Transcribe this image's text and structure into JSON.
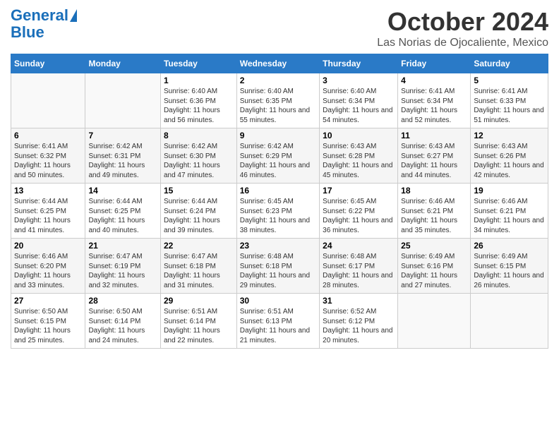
{
  "logo": {
    "line1": "General",
    "line2": "Blue"
  },
  "title": "October 2024",
  "subtitle": "Las Norias de Ojocaliente, Mexico",
  "days_of_week": [
    "Sunday",
    "Monday",
    "Tuesday",
    "Wednesday",
    "Thursday",
    "Friday",
    "Saturday"
  ],
  "weeks": [
    [
      {
        "day": "",
        "content": ""
      },
      {
        "day": "",
        "content": ""
      },
      {
        "day": "1",
        "content": "Sunrise: 6:40 AM\nSunset: 6:36 PM\nDaylight: 11 hours and 56 minutes."
      },
      {
        "day": "2",
        "content": "Sunrise: 6:40 AM\nSunset: 6:35 PM\nDaylight: 11 hours and 55 minutes."
      },
      {
        "day": "3",
        "content": "Sunrise: 6:40 AM\nSunset: 6:34 PM\nDaylight: 11 hours and 54 minutes."
      },
      {
        "day": "4",
        "content": "Sunrise: 6:41 AM\nSunset: 6:34 PM\nDaylight: 11 hours and 52 minutes."
      },
      {
        "day": "5",
        "content": "Sunrise: 6:41 AM\nSunset: 6:33 PM\nDaylight: 11 hours and 51 minutes."
      }
    ],
    [
      {
        "day": "6",
        "content": "Sunrise: 6:41 AM\nSunset: 6:32 PM\nDaylight: 11 hours and 50 minutes."
      },
      {
        "day": "7",
        "content": "Sunrise: 6:42 AM\nSunset: 6:31 PM\nDaylight: 11 hours and 49 minutes."
      },
      {
        "day": "8",
        "content": "Sunrise: 6:42 AM\nSunset: 6:30 PM\nDaylight: 11 hours and 47 minutes."
      },
      {
        "day": "9",
        "content": "Sunrise: 6:42 AM\nSunset: 6:29 PM\nDaylight: 11 hours and 46 minutes."
      },
      {
        "day": "10",
        "content": "Sunrise: 6:43 AM\nSunset: 6:28 PM\nDaylight: 11 hours and 45 minutes."
      },
      {
        "day": "11",
        "content": "Sunrise: 6:43 AM\nSunset: 6:27 PM\nDaylight: 11 hours and 44 minutes."
      },
      {
        "day": "12",
        "content": "Sunrise: 6:43 AM\nSunset: 6:26 PM\nDaylight: 11 hours and 42 minutes."
      }
    ],
    [
      {
        "day": "13",
        "content": "Sunrise: 6:44 AM\nSunset: 6:25 PM\nDaylight: 11 hours and 41 minutes."
      },
      {
        "day": "14",
        "content": "Sunrise: 6:44 AM\nSunset: 6:25 PM\nDaylight: 11 hours and 40 minutes."
      },
      {
        "day": "15",
        "content": "Sunrise: 6:44 AM\nSunset: 6:24 PM\nDaylight: 11 hours and 39 minutes."
      },
      {
        "day": "16",
        "content": "Sunrise: 6:45 AM\nSunset: 6:23 PM\nDaylight: 11 hours and 38 minutes."
      },
      {
        "day": "17",
        "content": "Sunrise: 6:45 AM\nSunset: 6:22 PM\nDaylight: 11 hours and 36 minutes."
      },
      {
        "day": "18",
        "content": "Sunrise: 6:46 AM\nSunset: 6:21 PM\nDaylight: 11 hours and 35 minutes."
      },
      {
        "day": "19",
        "content": "Sunrise: 6:46 AM\nSunset: 6:21 PM\nDaylight: 11 hours and 34 minutes."
      }
    ],
    [
      {
        "day": "20",
        "content": "Sunrise: 6:46 AM\nSunset: 6:20 PM\nDaylight: 11 hours and 33 minutes."
      },
      {
        "day": "21",
        "content": "Sunrise: 6:47 AM\nSunset: 6:19 PM\nDaylight: 11 hours and 32 minutes."
      },
      {
        "day": "22",
        "content": "Sunrise: 6:47 AM\nSunset: 6:18 PM\nDaylight: 11 hours and 31 minutes."
      },
      {
        "day": "23",
        "content": "Sunrise: 6:48 AM\nSunset: 6:18 PM\nDaylight: 11 hours and 29 minutes."
      },
      {
        "day": "24",
        "content": "Sunrise: 6:48 AM\nSunset: 6:17 PM\nDaylight: 11 hours and 28 minutes."
      },
      {
        "day": "25",
        "content": "Sunrise: 6:49 AM\nSunset: 6:16 PM\nDaylight: 11 hours and 27 minutes."
      },
      {
        "day": "26",
        "content": "Sunrise: 6:49 AM\nSunset: 6:15 PM\nDaylight: 11 hours and 26 minutes."
      }
    ],
    [
      {
        "day": "27",
        "content": "Sunrise: 6:50 AM\nSunset: 6:15 PM\nDaylight: 11 hours and 25 minutes."
      },
      {
        "day": "28",
        "content": "Sunrise: 6:50 AM\nSunset: 6:14 PM\nDaylight: 11 hours and 24 minutes."
      },
      {
        "day": "29",
        "content": "Sunrise: 6:51 AM\nSunset: 6:14 PM\nDaylight: 11 hours and 22 minutes."
      },
      {
        "day": "30",
        "content": "Sunrise: 6:51 AM\nSunset: 6:13 PM\nDaylight: 11 hours and 21 minutes."
      },
      {
        "day": "31",
        "content": "Sunrise: 6:52 AM\nSunset: 6:12 PM\nDaylight: 11 hours and 20 minutes."
      },
      {
        "day": "",
        "content": ""
      },
      {
        "day": "",
        "content": ""
      }
    ]
  ]
}
